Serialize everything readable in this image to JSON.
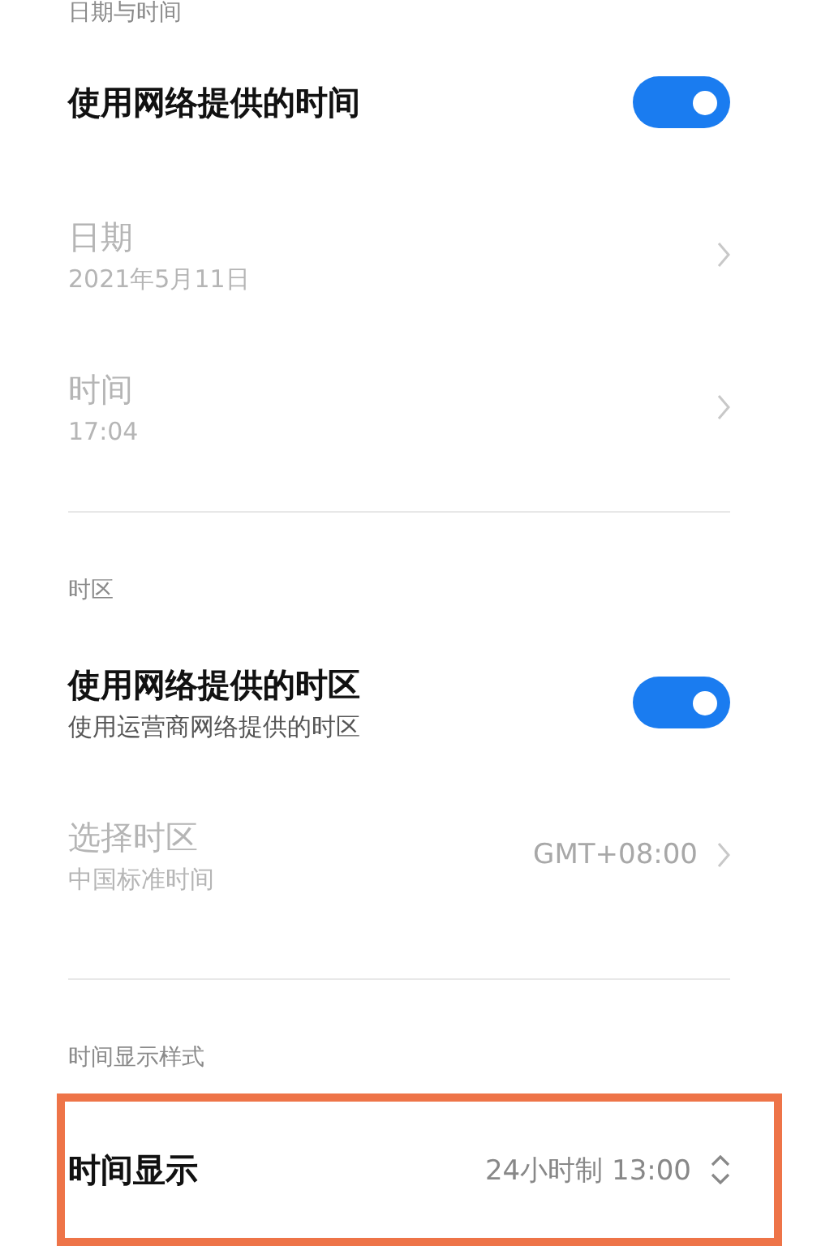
{
  "sections": [
    {
      "header": "日期与时间",
      "rows": [
        {
          "kind": "toggle",
          "title": "使用网络提供的时间",
          "on": true
        },
        {
          "kind": "link",
          "title": "日期",
          "subtitle": "2021年5月11日",
          "disabled": true
        },
        {
          "kind": "link",
          "title": "时间",
          "subtitle": "17:04",
          "disabled": true
        }
      ]
    },
    {
      "header": "时区",
      "rows": [
        {
          "kind": "toggle",
          "title": "使用网络提供的时区",
          "subtitle": "使用运营商网络提供的时区",
          "on": true
        },
        {
          "kind": "link",
          "title": "选择时区",
          "subtitle": "中国标准时间",
          "value": "GMT+08:00",
          "disabled": true
        }
      ]
    },
    {
      "header": "时间显示样式",
      "rows": [
        {
          "kind": "picker",
          "title": "时间显示",
          "value": "24小时制 13:00",
          "disabled": false,
          "highlighted": true
        }
      ]
    }
  ]
}
